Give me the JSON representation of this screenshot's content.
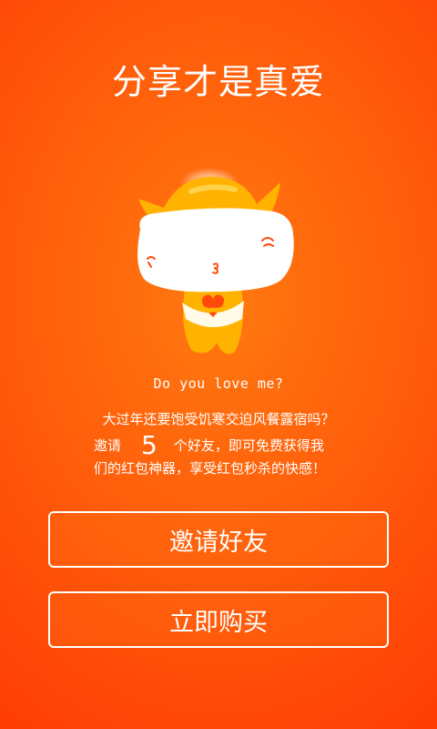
{
  "title": "分享才是真爱",
  "love_text": "Do you love me?",
  "message": {
    "line1": "大过年还要饱受饥寒交迫风餐露宿吗？",
    "invite_prefix": "邀请",
    "invite_count": "5",
    "invite_suffix": "个好友，即可免费获得我",
    "line3": "们的红包神器，享受红包秒杀的快感！"
  },
  "buttons": {
    "invite_label": "邀请好友",
    "buy_label": "立即购买"
  },
  "colors": {
    "background_center": "#ff7a10",
    "background_edge": "#ff3e06",
    "mascot_hat": "#ffb300",
    "mascot_heart": "#ff4a0a"
  },
  "icons": {
    "mascot": "cat-mascot-holding-heart"
  }
}
